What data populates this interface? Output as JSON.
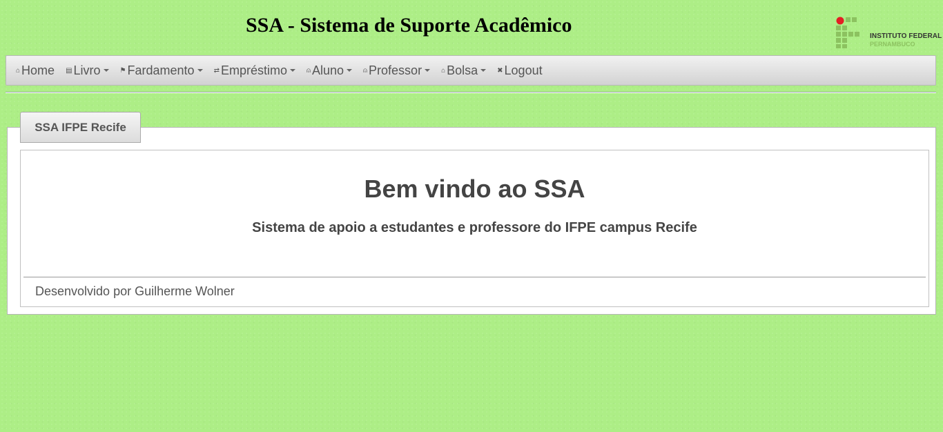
{
  "header": {
    "title": "SSA - Sistema de Suporte Acadêmico",
    "logo": {
      "line1": "INSTITUTO FEDERAL",
      "line2": "PERNAMBUCO",
      "colors": {
        "dot": "#e31e24",
        "blocks": "#8cc260"
      }
    }
  },
  "navbar": {
    "items": [
      {
        "label": "Home",
        "icon": "home-icon",
        "glyph": "⌂"
      },
      {
        "label": "Livro",
        "icon": "book-icon",
        "glyph": "▤"
      },
      {
        "label": "Fardamento",
        "icon": "flag-icon",
        "glyph": "⚑"
      },
      {
        "label": "Empréstimo",
        "icon": "transfer-icon",
        "glyph": "⇄"
      },
      {
        "label": "Aluno",
        "icon": "user-icon",
        "glyph": "⍝"
      },
      {
        "label": "Professor",
        "icon": "user-icon",
        "glyph": "⍝"
      },
      {
        "label": "Bolsa",
        "icon": "briefcase-icon",
        "glyph": "⌂"
      },
      {
        "label": "Logout",
        "icon": "close-icon",
        "glyph": "✖"
      }
    ]
  },
  "tab": {
    "label": "SSA IFPE Recife"
  },
  "content": {
    "heading": "Bem vindo ao SSA",
    "subtitle": "Sistema de apoio a estudantes e professore do IFPE campus Recife",
    "footer": "Desenvolvido por Guilherme Wolner"
  },
  "colors": {
    "background": "#adee86"
  }
}
